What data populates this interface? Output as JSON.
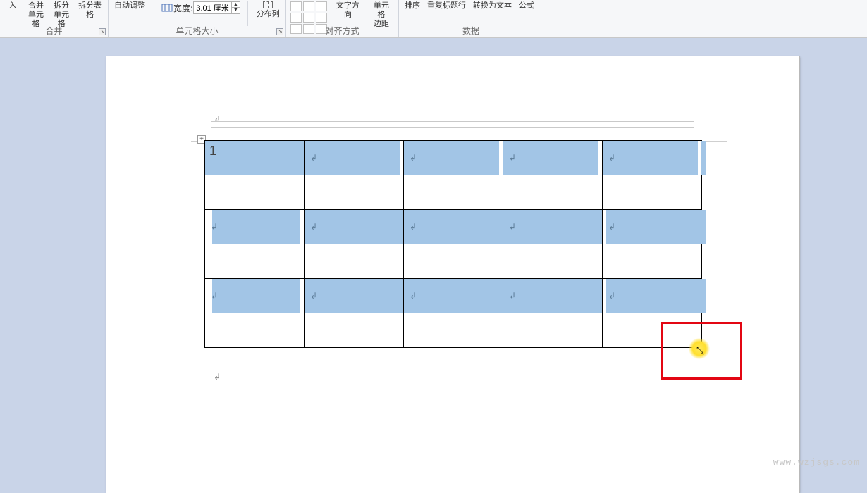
{
  "ribbon": {
    "group_merge": {
      "label": "合并",
      "insert_top": "入",
      "merge_cells": "合并\n单元格",
      "split_cells": "拆分\n单元格",
      "split_table": "拆分表格"
    },
    "group_cellsize": {
      "label": "单元格大小",
      "autofit": "自动调整",
      "width_label": "宽度:",
      "width_value": "3.01 厘米",
      "distribute_cols": "分布列"
    },
    "group_align": {
      "label": "对齐方式",
      "text_direction": "文字方向",
      "cell_margins": "单元格\n边距"
    },
    "group_data": {
      "label": "数据",
      "sort": "排序",
      "repeat_header": "重复标题行",
      "convert_to_text": "转换为文本",
      "formula": "公式"
    }
  },
  "document": {
    "table": {
      "rows": 6,
      "cols": 5,
      "first_cell_text": "1",
      "selected_rows": [
        0,
        2,
        4
      ]
    }
  },
  "watermark": "www.wzjsgs.com"
}
